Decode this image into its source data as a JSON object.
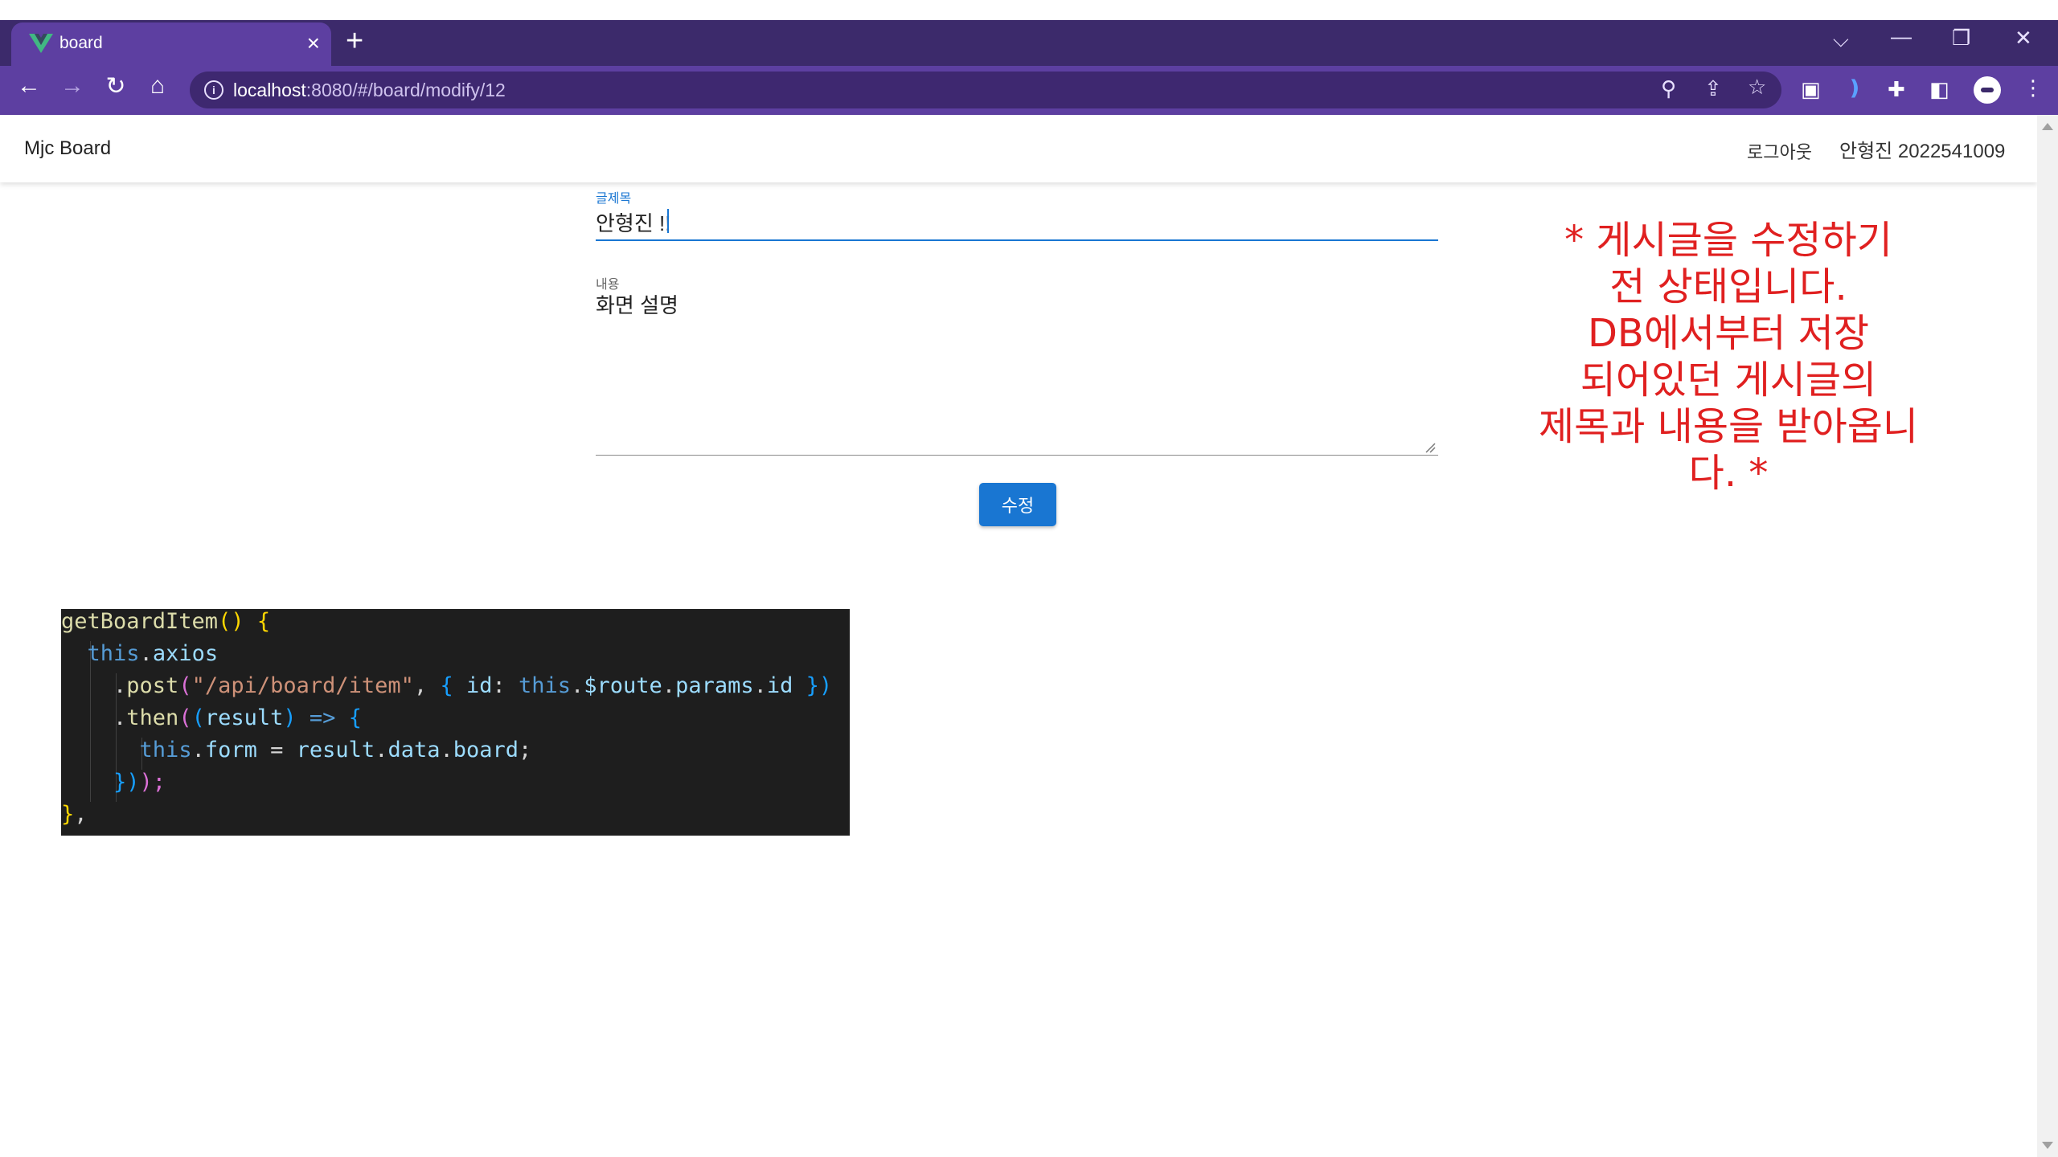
{
  "browser": {
    "tab_title": "board",
    "tab_close": "×",
    "new_tab": "+",
    "url_host": "localhost",
    "url_path": ":8080/#/board/modify/12",
    "window_controls": {
      "dropdown": "⌵",
      "minimize": "—",
      "restore": "❐",
      "close": "✕"
    },
    "nav": {
      "back": "←",
      "forward": "→",
      "reload": "↻",
      "home": "⌂"
    },
    "url_icons": {
      "zoom": "⚲",
      "share": "⇪",
      "star": "☆"
    },
    "ext_icons": {
      "ext1": "▣",
      "ext2": "❫",
      "puzzle": "✚",
      "sidepanel": "◧",
      "menu": "⋮"
    }
  },
  "app": {
    "title": "Mjc Board",
    "logout_label": "로그아웃",
    "user_info": "안형진 2022541009"
  },
  "form": {
    "title_label": "글제목",
    "title_value": "안형진 !!",
    "content_label": "내용",
    "content_value": "화면 설명",
    "submit_label": "수정"
  },
  "annotation": {
    "lines": [
      "* 게시글을 수정하기",
      "전 상태입니다.",
      "DB에서부터 저장",
      "되어있던 게시글의",
      "제목과 내용을 받아옵니",
      "다. *"
    ]
  },
  "code": {
    "tokens": [
      [
        [
          "getBoardItem",
          "fn"
        ],
        [
          "() ",
          "b1"
        ],
        [
          "{",
          "b1"
        ]
      ],
      [
        [
          "  ",
          ""
        ],
        [
          "this",
          "kw"
        ],
        [
          ".",
          ""
        ],
        [
          "axios",
          "prop"
        ]
      ],
      [
        [
          "    .",
          ""
        ],
        [
          "post",
          "fn"
        ],
        [
          "(",
          "b2"
        ],
        [
          "\"/api/board/item\"",
          "str"
        ],
        [
          ", ",
          ""
        ],
        [
          "{ ",
          "b3"
        ],
        [
          "id",
          "prop"
        ],
        [
          ": ",
          ""
        ],
        [
          "this",
          "kw"
        ],
        [
          ".",
          ""
        ],
        [
          "$route",
          "prop"
        ],
        [
          ".",
          ""
        ],
        [
          "params",
          "prop"
        ],
        [
          ".",
          ""
        ],
        [
          "id",
          "prop"
        ],
        [
          " })",
          "b3"
        ]
      ],
      [
        [
          "    .",
          ""
        ],
        [
          "then",
          "fn"
        ],
        [
          "(",
          "b2"
        ],
        [
          "(",
          "b3"
        ],
        [
          "result",
          "prop"
        ],
        [
          ") ",
          "b3"
        ],
        [
          "=> ",
          "kw"
        ],
        [
          "{",
          "b3"
        ]
      ],
      [
        [
          "      ",
          ""
        ],
        [
          "this",
          "kw"
        ],
        [
          ".",
          ""
        ],
        [
          "form",
          "prop"
        ],
        [
          " = ",
          ""
        ],
        [
          "result",
          "prop"
        ],
        [
          ".",
          ""
        ],
        [
          "data",
          "prop"
        ],
        [
          ".",
          ""
        ],
        [
          "board",
          "prop"
        ],
        [
          ";",
          ""
        ]
      ],
      [
        [
          "    ",
          ""
        ],
        [
          "})",
          "b3"
        ],
        [
          ");",
          "b2"
        ]
      ],
      [
        [
          "}",
          "b1"
        ],
        [
          ",",
          ""
        ]
      ]
    ]
  }
}
